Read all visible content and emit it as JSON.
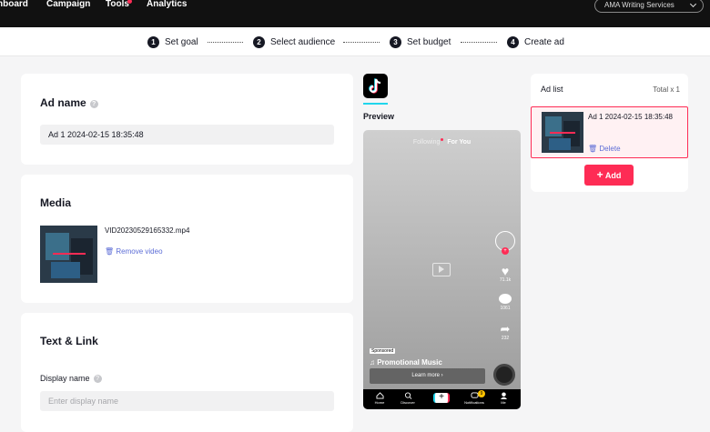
{
  "nav": {
    "items": [
      "nboard",
      "Campaign",
      "Tools",
      "Analytics"
    ],
    "account": "AMA Writing Services"
  },
  "steps": [
    {
      "num": "1",
      "label": "Set goal"
    },
    {
      "num": "2",
      "label": "Select audience"
    },
    {
      "num": "3",
      "label": "Set budget"
    },
    {
      "num": "4",
      "label": "Create ad"
    }
  ],
  "ad_name": {
    "title": "Ad name",
    "value": "Ad 1 2024-02-15 18:35:48"
  },
  "media": {
    "title": "Media",
    "filename": "VID20230529165332.mp4",
    "remove_label": "Remove video"
  },
  "text_link": {
    "title": "Text & Link",
    "display_name_label": "Display name",
    "display_name_placeholder": "Enter display name"
  },
  "preview": {
    "label": "Preview",
    "tabs": {
      "following": "Following",
      "for_you": "For You"
    },
    "likes": "71.1k",
    "comments": "1061",
    "shares": "232",
    "sponsored": "Sponsored",
    "music": "♫ Promotional Music",
    "learn_more": "Learn more  ›",
    "bottom_nav": [
      "Home",
      "Discover",
      "Notifications",
      "Me"
    ],
    "notif_badge": "9"
  },
  "ad_list": {
    "title": "Ad list",
    "total": "Total x 1",
    "item_name": "Ad 1 2024-02-15 18:35:48",
    "delete_label": "Delete",
    "add_label": "Add"
  },
  "colors": {
    "brand": "#fe2c55",
    "link": "#5b6cd6",
    "tiktok_cyan": "#20d5ec"
  }
}
